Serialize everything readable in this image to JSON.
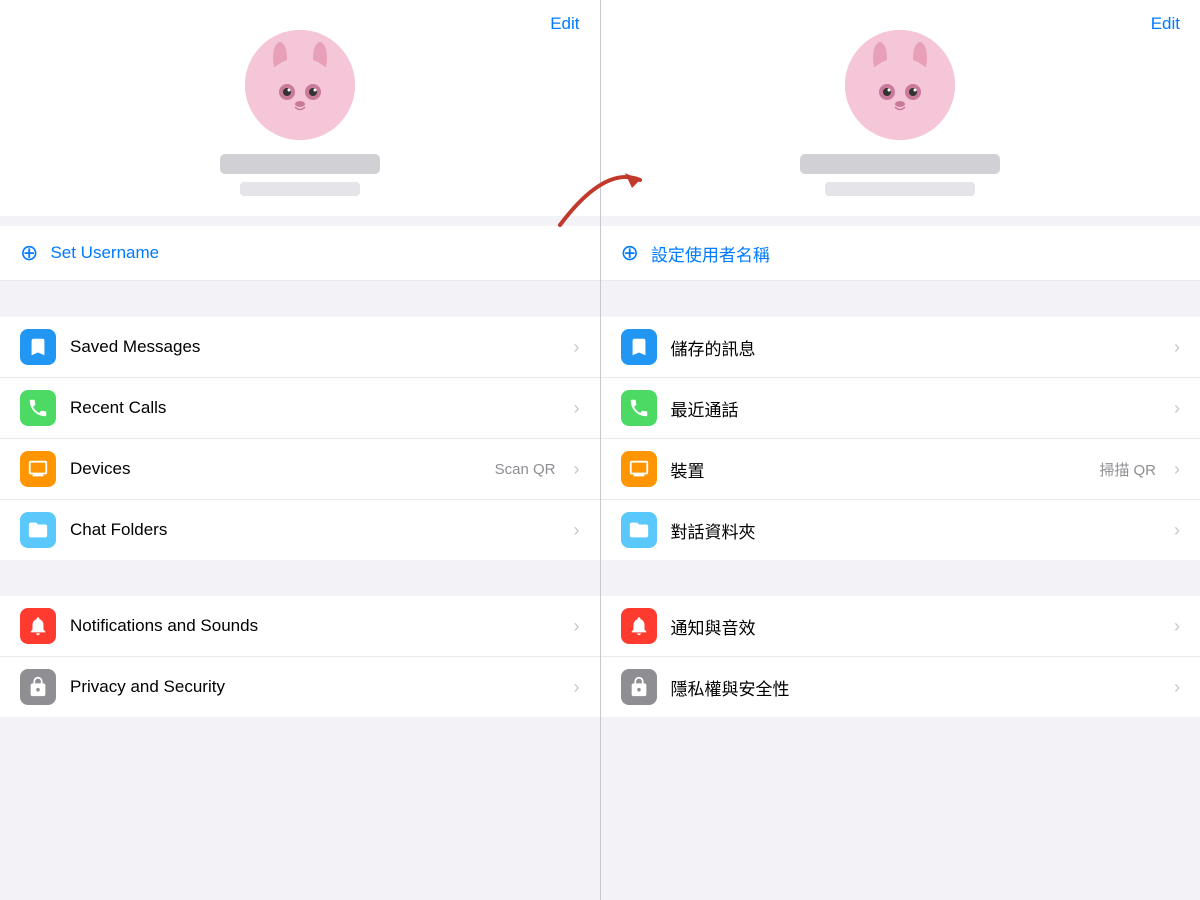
{
  "left": {
    "edit": "Edit",
    "username": {
      "icon": "username-icon",
      "label": "Set Username"
    },
    "menu_items": [
      {
        "id": "saved-messages",
        "icon_type": "blue",
        "label": "Saved Messages",
        "extra": "",
        "chevron": "›"
      },
      {
        "id": "recent-calls",
        "icon_type": "green",
        "label": "Recent Calls",
        "extra": "",
        "chevron": "›"
      },
      {
        "id": "devices",
        "icon_type": "orange",
        "label": "Devices",
        "extra": "Scan QR",
        "chevron": "›"
      },
      {
        "id": "chat-folders",
        "icon_type": "teal",
        "label": "Chat Folders",
        "extra": "",
        "chevron": "›"
      }
    ],
    "menu_items2": [
      {
        "id": "notifications",
        "icon_type": "red",
        "label": "Notifications and Sounds",
        "extra": "",
        "chevron": "›"
      },
      {
        "id": "privacy",
        "icon_type": "gray",
        "label": "Privacy and Security",
        "extra": "",
        "chevron": "›"
      }
    ]
  },
  "right": {
    "edit": "Edit",
    "username": {
      "icon": "username-icon",
      "label": "設定使用者名稱"
    },
    "menu_items": [
      {
        "id": "saved-messages-zh",
        "icon_type": "blue",
        "label": "儲存的訊息",
        "extra": "",
        "chevron": "›"
      },
      {
        "id": "recent-calls-zh",
        "icon_type": "green",
        "label": "最近通話",
        "extra": "",
        "chevron": "›"
      },
      {
        "id": "devices-zh",
        "icon_type": "orange",
        "label": "裝置",
        "extra": "掃描 QR",
        "chevron": "›"
      },
      {
        "id": "chat-folders-zh",
        "icon_type": "teal",
        "label": "對話資料夾",
        "extra": "",
        "chevron": "›"
      }
    ],
    "menu_items2": [
      {
        "id": "notifications-zh",
        "icon_type": "red",
        "label": "通知與音效",
        "extra": "",
        "chevron": "›"
      },
      {
        "id": "privacy-zh",
        "icon_type": "gray",
        "label": "隱私權與安全性",
        "extra": "",
        "chevron": "›"
      }
    ]
  },
  "colors": {
    "accent": "#007aff",
    "red": "#ff3b30",
    "separator": "#e0e0e5"
  }
}
